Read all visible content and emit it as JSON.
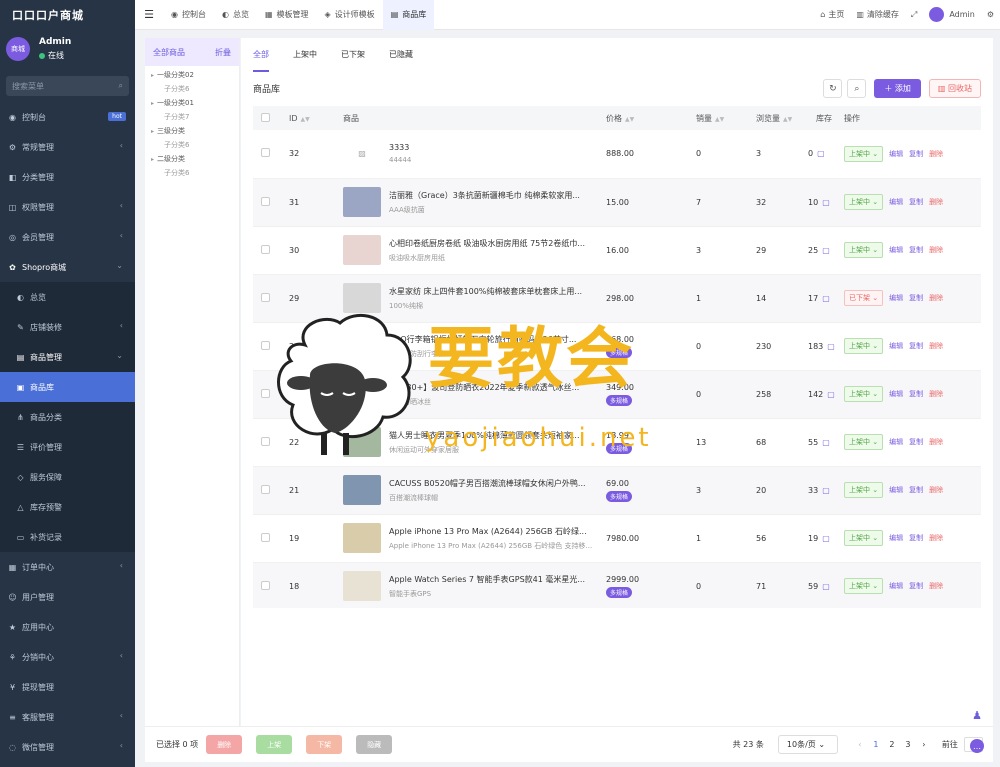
{
  "app": {
    "title": "口口口户商城"
  },
  "user": {
    "avatar_text": "商城",
    "avatar_sub": "B2C",
    "name": "Admin",
    "status": "在线"
  },
  "sidebar": {
    "search_placeholder": "搜索菜单",
    "items": [
      {
        "label": "控制台",
        "icon": "dashboard-icon",
        "badge": "hot",
        "arrow": ""
      },
      {
        "label": "常规管理",
        "icon": "gear-icon",
        "arrow": "‹"
      },
      {
        "label": "分类管理",
        "icon": "category-icon",
        "arrow": ""
      },
      {
        "label": "权限管理",
        "icon": "lock-icon",
        "arrow": "‹"
      },
      {
        "label": "会员管理",
        "icon": "user-icon",
        "arrow": "‹"
      },
      {
        "label": "Shopro商城",
        "icon": "shop-icon",
        "arrow": "⌄"
      },
      {
        "label": "总览",
        "icon": "overview-icon",
        "arrow": ""
      },
      {
        "label": "店铺装修",
        "icon": "brush-icon",
        "arrow": "‹"
      },
      {
        "label": "商品管理",
        "icon": "goods-icon",
        "arrow": "⌄"
      },
      {
        "label": "商品库",
        "icon": "library-icon",
        "arrow": ""
      },
      {
        "label": "商品分类",
        "icon": "tree-icon",
        "arrow": ""
      },
      {
        "label": "评价管理",
        "icon": "comment-icon",
        "arrow": ""
      },
      {
        "label": "服务保障",
        "icon": "shield-icon",
        "arrow": ""
      },
      {
        "label": "库存预警",
        "icon": "warning-icon",
        "arrow": ""
      },
      {
        "label": "补货记录",
        "icon": "record-icon",
        "arrow": ""
      },
      {
        "label": "订单中心",
        "icon": "order-icon",
        "arrow": "‹"
      },
      {
        "label": "用户管理",
        "icon": "users-icon",
        "arrow": ""
      },
      {
        "label": "应用中心",
        "icon": "app-icon",
        "arrow": ""
      },
      {
        "label": "分销中心",
        "icon": "share-icon",
        "arrow": "‹"
      },
      {
        "label": "提现管理",
        "icon": "yen-icon",
        "arrow": ""
      },
      {
        "label": "客服管理",
        "icon": "list-icon",
        "arrow": "‹"
      },
      {
        "label": "微信管理",
        "icon": "wechat-icon",
        "arrow": "‹"
      }
    ]
  },
  "topbar": {
    "tabs": [
      {
        "label": "控制台"
      },
      {
        "label": "总览"
      },
      {
        "label": "模板管理"
      },
      {
        "label": "设计师模板"
      },
      {
        "label": "商品库"
      }
    ],
    "home": "主页",
    "clear_cache": "清除缓存",
    "admin": "Admin"
  },
  "categories": {
    "all": "全部商品",
    "collapse": "折叠",
    "nodes": [
      {
        "name": "一级分类02",
        "child": "子分类6"
      },
      {
        "name": "一级分类01",
        "child": "子分类7"
      },
      {
        "name": "三级分类",
        "child": "子分类6"
      },
      {
        "name": "二级分类",
        "child": "子分类6"
      }
    ]
  },
  "tabs": [
    {
      "label": "全部"
    },
    {
      "label": "上架中"
    },
    {
      "label": "已下架"
    },
    {
      "label": "已隐藏"
    }
  ],
  "library_title": "商品库",
  "actions": {
    "add": "添加",
    "recycle": "回收站"
  },
  "table": {
    "headers": {
      "id": "ID",
      "product": "商品",
      "price": "价格",
      "sales": "销量",
      "views": "浏览量",
      "stock": "库存",
      "ops": "操作"
    },
    "op_edit": "编辑",
    "op_copy": "复制",
    "op_delete": "删除",
    "rows": [
      {
        "id": "32",
        "name": "3333",
        "sub": "44444",
        "price": "888.00",
        "tag": "",
        "sales": "0",
        "views": "3",
        "stock": "0",
        "status": "上架中",
        "status_off": false,
        "thumb": ""
      },
      {
        "id": "31",
        "name": "洁丽雅（Grace）3条抗菌新疆棉毛巾 纯棉柔软家用...",
        "sub": "AAA级抗菌",
        "price": "15.00",
        "tag": "",
        "sales": "7",
        "views": "32",
        "stock": "10",
        "status": "上架中",
        "status_off": false,
        "thumb": "#9aa6c4"
      },
      {
        "id": "30",
        "name": "心相印卷纸厨房卷纸 吸油吸水厨房用纸 75节2卷纸巾...",
        "sub": "吸油吸水厨房用纸",
        "price": "16.00",
        "tag": "",
        "sales": "3",
        "views": "29",
        "stock": "25",
        "status": "上架中",
        "status_off": false,
        "thumb": "#e8d4d0"
      },
      {
        "id": "29",
        "name": "水星家纺 床上四件套100%纯棉被套床单枕套床上用...",
        "sub": "100%纯棉",
        "price": "298.00",
        "tag": "",
        "sales": "1",
        "views": "14",
        "stock": "17",
        "status": "已下架",
        "status_off": true,
        "thumb": "#d8d8d8"
      },
      {
        "id": "26",
        "name": "SOO行李箱铝框拉杆箱万向轮旅行箱密码箱26英寸...",
        "sub": "大容量防刮行李箱",
        "price": "168.00",
        "tag": "多规格",
        "sales": "0",
        "views": "230",
        "stock": "183",
        "status": "上架中",
        "status_off": false,
        "thumb": "#b9c8d8"
      },
      {
        "id": "24",
        "name": "【PF80+】波司登防晒衣2022年夏季新款透气冰丝...",
        "sub": "透气防晒冰丝",
        "price": "349.00",
        "tag": "多规格",
        "sales": "0",
        "views": "258",
        "stock": "142",
        "status": "上架中",
        "status_off": false,
        "thumb": "#8d8d8d"
      },
      {
        "id": "22",
        "name": "猫人男士睡衣男夏季100%纯棉薄款圆领套头短袖家...",
        "sub": "休闲运动可外穿家居服",
        "price": "18.99",
        "tag": "多规格",
        "sales": "13",
        "views": "68",
        "stock": "55",
        "status": "上架中",
        "status_off": false,
        "thumb": "#a4b8a0"
      },
      {
        "id": "21",
        "name": "CACUSS B0520帽子男百搭潮流棒球帽女休闲户外鸭...",
        "sub": "百搭潮流棒球帽",
        "price": "69.00",
        "tag": "多规格",
        "sales": "3",
        "views": "20",
        "stock": "33",
        "status": "上架中",
        "status_off": false,
        "thumb": "#7f95b0"
      },
      {
        "id": "19",
        "name": "Apple iPhone 13 Pro Max (A2644) 256GB 石岭绿...",
        "sub": "Apple iPhone 13 Pro Max (A2644) 256GB 石岭绿色 支持移...",
        "price": "7980.00",
        "tag": "",
        "sales": "1",
        "views": "56",
        "stock": "19",
        "status": "上架中",
        "status_off": false,
        "thumb": "#d9ccaa"
      },
      {
        "id": "18",
        "name": "Apple Watch Series 7 智能手表GPS款41 毫米星光...",
        "sub": "智能手表GPS",
        "price": "2999.00",
        "tag": "多规格",
        "sales": "0",
        "views": "71",
        "stock": "59",
        "status": "上架中",
        "status_off": false,
        "thumb": "#e8e2d4"
      }
    ]
  },
  "footer": {
    "selected": "已选择 0 项",
    "delete": "删除",
    "on": "上架",
    "off": "下架",
    "hide": "隐藏",
    "total": "共 23 条",
    "page_size": "10条/页",
    "pages": [
      "1",
      "2",
      "3"
    ],
    "goto_label": "前往",
    "goto_value": "1"
  },
  "watermark": {
    "cn": "要教会",
    "en": "yaojiaohui.net"
  },
  "colors": {
    "primary": "#7b5ce0",
    "sidebar": "#263445",
    "danger": "#e86767",
    "success": "#52a845"
  }
}
